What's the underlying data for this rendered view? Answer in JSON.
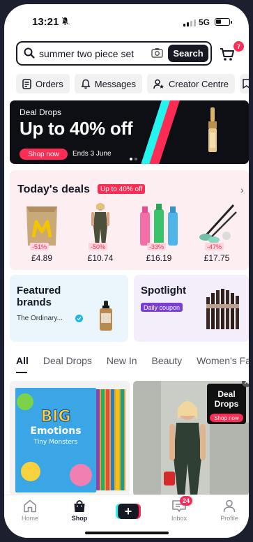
{
  "status": {
    "time": "13:21",
    "network": "5G"
  },
  "search": {
    "query": "summer two piece set",
    "button": "Search"
  },
  "cart": {
    "count": "7"
  },
  "quick_links": [
    {
      "label": "Orders",
      "icon": "orders-icon"
    },
    {
      "label": "Messages",
      "icon": "bell-icon"
    },
    {
      "label": "Creator Centre",
      "icon": "creator-icon"
    }
  ],
  "banner": {
    "kicker": "Deal Drops",
    "headline": "Up to 40% off",
    "cta": "Shop now",
    "ends": "Ends 3 June"
  },
  "deals": {
    "title": "Today's deals",
    "tag": "Up to 40% off",
    "products": [
      {
        "name": "bag",
        "discount": "-51%",
        "price": "£4.89"
      },
      {
        "name": "jumpsuit",
        "discount": "-50%",
        "price": "£10.74"
      },
      {
        "name": "sprays",
        "discount": "-33%",
        "price": "£16.19"
      },
      {
        "name": "brush",
        "discount": "-47%",
        "price": "£17.75"
      }
    ]
  },
  "featured": {
    "title": "Featured brands",
    "brand": "The Ordinary..."
  },
  "spotlight": {
    "title": "Spotlight",
    "tag": "Daily coupon"
  },
  "tabs": [
    "All",
    "Deal Drops",
    "New In",
    "Beauty",
    "Women's Fa"
  ],
  "cards": {
    "book": {
      "line1": "BIG",
      "line2": "Emotions",
      "line3": "Tiny Monsters"
    },
    "promo": {
      "line1": "Deal",
      "line2": "Drops",
      "cta": "Shop now"
    }
  },
  "nav": {
    "items": [
      {
        "label": "Home",
        "icon": "home-icon"
      },
      {
        "label": "Shop",
        "icon": "shop-bag-icon"
      },
      {
        "label": "Inbox",
        "icon": "inbox-icon"
      },
      {
        "label": "Profile",
        "icon": "profile-icon"
      }
    ],
    "inbox_badge": "24"
  },
  "colors": {
    "brand_red": "#fe2c55",
    "brand_cyan": "#25f4ee",
    "ink": "#161823"
  }
}
